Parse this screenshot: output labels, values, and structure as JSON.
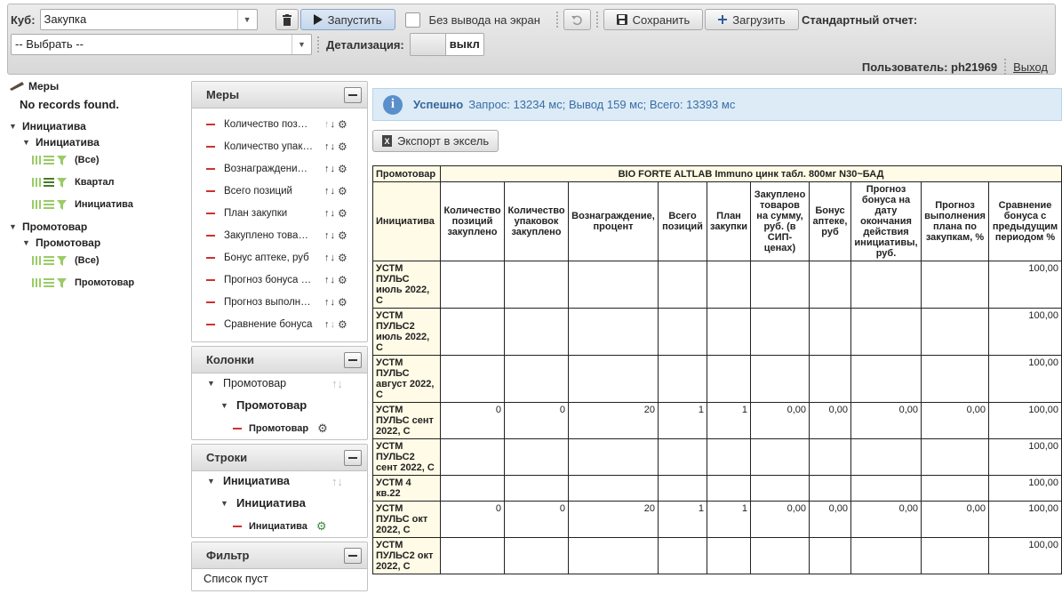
{
  "toolbar": {
    "cube_label": "Куб:",
    "cube_value": "Закупка",
    "select_value": "-- Выбрать --",
    "run_label": "Запустить",
    "no_output_label": "Без вывода на экран",
    "save_label": "Сохранить",
    "load_label": "Загрузить",
    "standard_report_label": "Стандартный отчет:",
    "detail_label": "Детализация:",
    "detail_value": "выкл",
    "user_text": "Пользователь: ph21969",
    "logout_label": "Выход"
  },
  "left_tree": {
    "measures_title": "Меры",
    "no_records": "No records found.",
    "initiative_root": "Инициатива",
    "initiative_hier": "Инициатива",
    "initiative_levels": [
      "(Все)",
      "Квартал",
      "Инициатива"
    ],
    "promo_root": "Промотовар",
    "promo_hier": "Промотовар",
    "promo_levels": [
      "(Все)",
      "Промотовар"
    ]
  },
  "measures_panel": {
    "title": "Меры",
    "items": [
      "Количество позиций закуплено",
      "Количество упаковок закуплено",
      "Вознаграждение, процент",
      "Всего позиций",
      "План закупки",
      "Закуплено товаров на сумму",
      "Бонус аптеке, руб",
      "Прогноз бонуса на дату",
      "Прогноз выполнения плана",
      "Сравнение бонуса"
    ]
  },
  "columns_panel": {
    "title": "Колонки",
    "dimension": "Промотовар",
    "hierarchy": "Промотовар",
    "level": "Промотовар"
  },
  "rows_panel": {
    "title": "Строки",
    "dimension": "Инициатива",
    "hierarchy": "Инициатива",
    "level": "Инициатива"
  },
  "filter_panel": {
    "title": "Фильтр",
    "empty_text": "Список пуст"
  },
  "alert": {
    "status": "Успешно",
    "message": "Запрос: 13234 мс; Вывод 159 мс; Всего: 13393 мс"
  },
  "export_label": "Экспорт в эксель",
  "grid": {
    "corner_label": "Промотовар",
    "product_header": "BIO FORTE ALTLAB Immuno цинк табл. 800мг N30~БАД",
    "row_dim_label": "Инициатива",
    "columns": [
      "Количество позиций закуплено",
      "Количество упаковок закуплено",
      "Вознаграждение, процент",
      "Всего позиций",
      "План закупки",
      "Закуплено товаров на сумму, руб. (в СИП-ценах)",
      "Бонус аптеке, руб",
      "Прогноз бонуса на дату окончания действия инициативы, руб.",
      "Прогноз выполнения плана по закупкам, %",
      "Сравнение бонуса с предыдущим периодом %"
    ],
    "rows": [
      {
        "label": "УСТМ ПУЛЬС июль 2022, С",
        "cells": [
          "",
          "",
          "",
          "",
          "",
          "",
          "",
          "",
          "",
          "100,00"
        ]
      },
      {
        "label": "УСТМ ПУЛЬС2 июль 2022, С",
        "cells": [
          "",
          "",
          "",
          "",
          "",
          "",
          "",
          "",
          "",
          "100,00"
        ]
      },
      {
        "label": "УСТМ ПУЛЬС август 2022, С",
        "cells": [
          "",
          "",
          "",
          "",
          "",
          "",
          "",
          "",
          "",
          "100,00"
        ]
      },
      {
        "label": "УСТМ ПУЛЬС сент 2022, С",
        "cells": [
          "0",
          "0",
          "20",
          "1",
          "1",
          "0,00",
          "0,00",
          "0,00",
          "0,00",
          "100,00"
        ]
      },
      {
        "label": "УСТМ ПУЛЬС2 сент 2022, С",
        "cells": [
          "",
          "",
          "",
          "",
          "",
          "",
          "",
          "",
          "",
          "100,00"
        ]
      },
      {
        "label": "УСТМ 4 кв.22",
        "cells": [
          "",
          "",
          "",
          "",
          "",
          "",
          "",
          "",
          "",
          "100,00"
        ]
      },
      {
        "label": "УСТМ ПУЛЬС окт 2022, С",
        "cells": [
          "0",
          "0",
          "20",
          "1",
          "1",
          "0,00",
          "0,00",
          "0,00",
          "0,00",
          "100,00"
        ]
      },
      {
        "label": "УСТМ ПУЛЬС2 окт 2022, С",
        "cells": [
          "",
          "",
          "",
          "",
          "",
          "",
          "",
          "",
          "",
          "100,00"
        ]
      }
    ]
  }
}
